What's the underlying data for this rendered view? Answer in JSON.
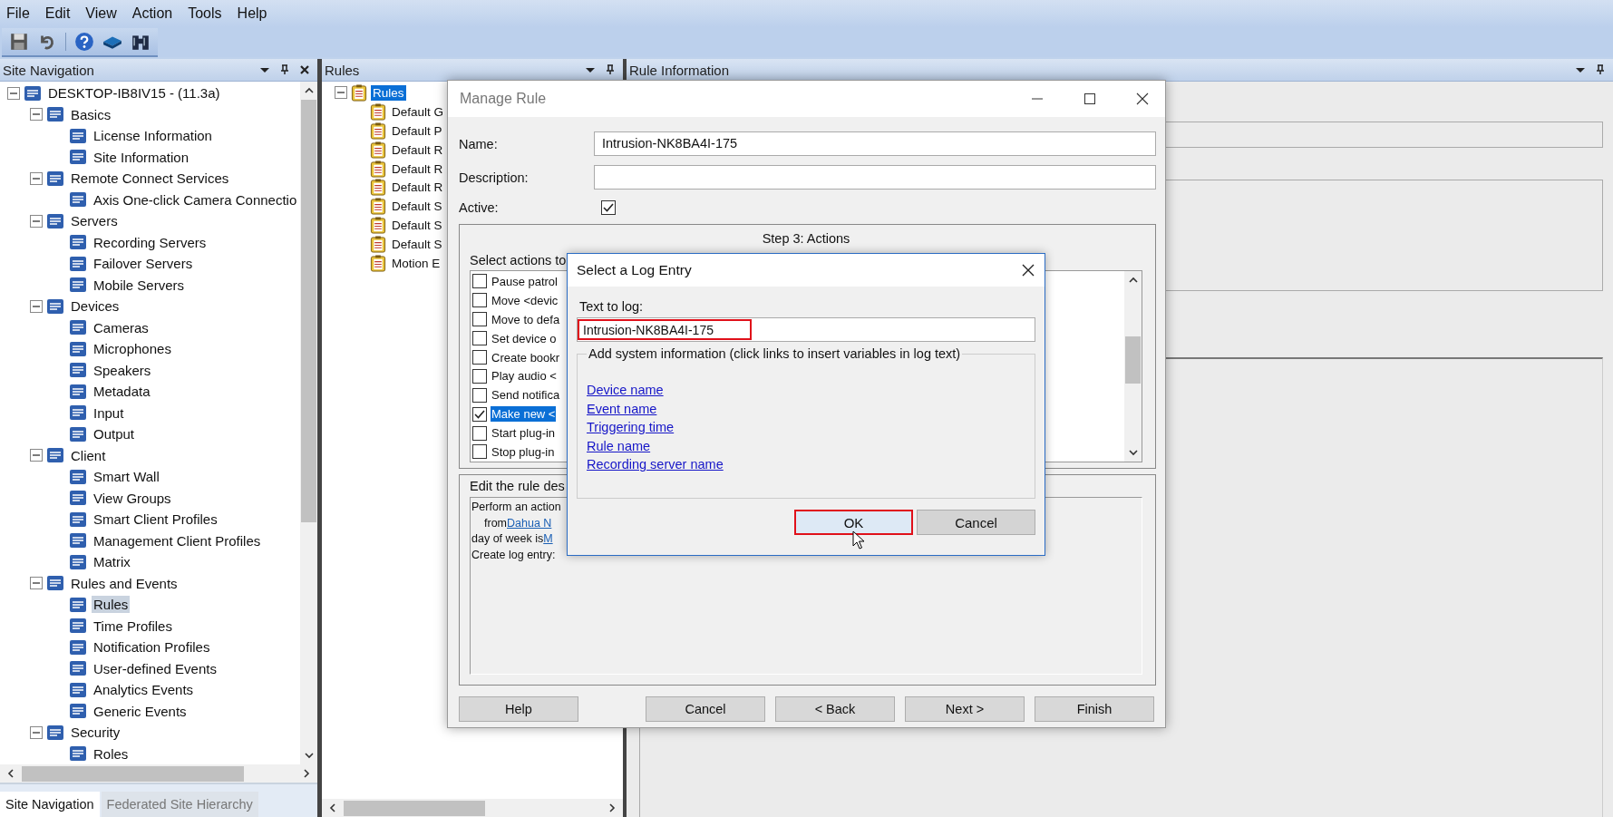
{
  "menu": [
    "File",
    "Edit",
    "View",
    "Action",
    "Tools",
    "Help"
  ],
  "site_navigation": {
    "title": "Site Navigation",
    "tree": [
      {
        "label": "DESKTOP-IB8IV15 - (11.3a)",
        "expanded": true,
        "selected": false,
        "children": [
          {
            "label": "Basics",
            "expanded": true,
            "selected": false,
            "children": [
              {
                "label": "License Information",
                "selected": false
              },
              {
                "label": "Site Information",
                "selected": false
              }
            ]
          },
          {
            "label": "Remote Connect Services",
            "expanded": true,
            "selected": false,
            "children": [
              {
                "label": "Axis One-click Camera Connectio",
                "selected": false
              }
            ]
          },
          {
            "label": "Servers",
            "expanded": true,
            "selected": false,
            "children": [
              {
                "label": "Recording Servers",
                "selected": false
              },
              {
                "label": "Failover Servers",
                "selected": false
              },
              {
                "label": "Mobile Servers",
                "selected": false
              }
            ]
          },
          {
            "label": "Devices",
            "expanded": true,
            "selected": false,
            "children": [
              {
                "label": "Cameras",
                "selected": false
              },
              {
                "label": "Microphones",
                "selected": false
              },
              {
                "label": "Speakers",
                "selected": false
              },
              {
                "label": "Metadata",
                "selected": false
              },
              {
                "label": "Input",
                "selected": false
              },
              {
                "label": "Output",
                "selected": false
              }
            ]
          },
          {
            "label": "Client",
            "expanded": true,
            "selected": false,
            "children": [
              {
                "label": "Smart Wall",
                "selected": false
              },
              {
                "label": "View Groups",
                "selected": false
              },
              {
                "label": "Smart Client Profiles",
                "selected": false
              },
              {
                "label": "Management Client Profiles",
                "selected": false
              },
              {
                "label": "Matrix",
                "selected": false
              }
            ]
          },
          {
            "label": "Rules and Events",
            "expanded": true,
            "selected": false,
            "children": [
              {
                "label": "Rules",
                "selected": true
              },
              {
                "label": "Time Profiles",
                "selected": false
              },
              {
                "label": "Notification Profiles",
                "selected": false
              },
              {
                "label": "User-defined Events",
                "selected": false
              },
              {
                "label": "Analytics Events",
                "selected": false
              },
              {
                "label": "Generic Events",
                "selected": false
              }
            ]
          },
          {
            "label": "Security",
            "expanded": true,
            "selected": false,
            "children": [
              {
                "label": "Roles",
                "selected": false
              }
            ]
          }
        ]
      }
    ],
    "tabs": [
      {
        "label": "Site Navigation",
        "selected": true
      },
      {
        "label": "Federated Site Hierarchy",
        "selected": false
      }
    ]
  },
  "rules_panel": {
    "title": "Rules",
    "tree": [
      {
        "label": "Rules",
        "expanded": true,
        "selected": true,
        "children": [
          {
            "label": "Default G",
            "selected": false
          },
          {
            "label": "Default P",
            "selected": false
          },
          {
            "label": "Default R",
            "selected": false
          },
          {
            "label": "Default R",
            "selected": false
          },
          {
            "label": "Default R",
            "selected": false
          },
          {
            "label": "Default S",
            "selected": false
          },
          {
            "label": "Default S",
            "selected": false
          },
          {
            "label": "Default S",
            "selected": false
          },
          {
            "label": "Motion E",
            "selected": false
          }
        ]
      }
    ]
  },
  "rule_information": {
    "title": "Rule Information"
  },
  "manage_rule": {
    "title": "Manage Rule",
    "fields": [
      {
        "label": "Name:",
        "value": "Intrusion-NK8BA4I-175"
      },
      {
        "label": "Description:"
      }
    ],
    "active": {
      "label": "Active:",
      "checked": true
    },
    "step_title": "Step 3: Actions",
    "actions_label": "Select actions to",
    "actions": [
      {
        "label": "Pause patrol",
        "checked": false,
        "selected": false
      },
      {
        "label": "Move <devic",
        "checked": false,
        "selected": false
      },
      {
        "label": "Move to defa",
        "checked": false,
        "selected": false
      },
      {
        "label": "Set device o",
        "checked": false,
        "selected": false
      },
      {
        "label": "Create bookr",
        "checked": false,
        "selected": false
      },
      {
        "label": "Play audio <",
        "checked": false,
        "selected": false
      },
      {
        "label": "Send notifica",
        "checked": false,
        "selected": false
      },
      {
        "label": "Make new <",
        "checked": true,
        "selected": true
      },
      {
        "label": "Start plug-in",
        "checked": false,
        "selected": false
      },
      {
        "label": "Stop plug-in",
        "checked": false,
        "selected": false
      }
    ],
    "description_label": "Edit the rule des",
    "description": [
      {
        "kind": "plain",
        "text": "Perform an action"
      },
      {
        "kind": "indented",
        "text": "from",
        "link": "Dahua N"
      },
      {
        "kind": "plain",
        "text": "day of week is",
        "link": "M"
      },
      {
        "kind": "plain",
        "text": "Create log entry:"
      }
    ],
    "buttons": [
      "Help",
      "Cancel",
      "< Back",
      "Next >",
      "Finish"
    ]
  },
  "log_dialog": {
    "title": "Select a Log Entry",
    "text_label": "Text to log:",
    "text_value": "Intrusion-NK8BA4I-175",
    "text_highlighted": true,
    "group_label": "Add system information (click links to insert variables in log text)",
    "links": [
      "Device name",
      "Event name",
      "Triggering time",
      "Rule name",
      "Recording server name"
    ],
    "buttons": [
      {
        "label": "OK",
        "highlighted": true
      },
      {
        "label": "Cancel",
        "highlighted": false
      }
    ]
  }
}
